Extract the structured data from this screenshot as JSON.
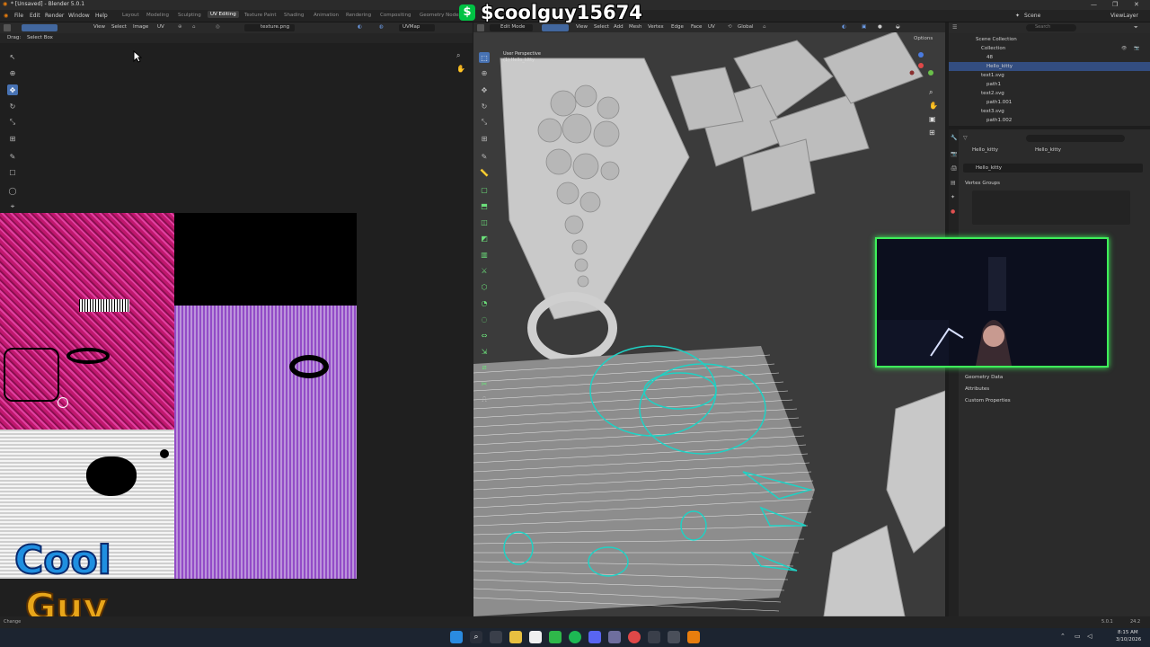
{
  "window": {
    "title": "* [Unsaved] - Blender 5.0.1",
    "controls": [
      "—",
      "❐",
      "✕"
    ]
  },
  "stream_overlay": {
    "username": "$coolguy15674",
    "cash_symbol": "$",
    "logo_text_1": "Cool",
    "logo_text_2": "Guy"
  },
  "menu": [
    "File",
    "Edit",
    "Render",
    "Window",
    "Help"
  ],
  "workspaces": [
    {
      "label": "Layout",
      "active": false
    },
    {
      "label": "Modeling",
      "active": false
    },
    {
      "label": "Sculpting",
      "active": false
    },
    {
      "label": "UV Editing",
      "active": true
    },
    {
      "label": "Texture Paint",
      "active": false
    },
    {
      "label": "Shading",
      "active": false
    },
    {
      "label": "Animation",
      "active": false
    },
    {
      "label": "Rendering",
      "active": false
    },
    {
      "label": "Compositing",
      "active": false
    },
    {
      "label": "Geometry Nodes",
      "active": false
    }
  ],
  "top_right": {
    "scene": "Scene",
    "view_layer": "ViewLayer"
  },
  "uv_editor": {
    "header": [
      "View",
      "Select",
      "Image",
      "UV"
    ],
    "image_name": "texture.png",
    "uv_map": "UVMap",
    "subheader": [
      "Drag:",
      "Select Box"
    ]
  },
  "viewport": {
    "mode": "Edit Mode",
    "header": [
      "View",
      "Select",
      "Add",
      "Mesh",
      "Vertex",
      "Edge",
      "Face",
      "UV"
    ],
    "transform": "Global",
    "options": "Options",
    "overlay_text_1": "User Perspective",
    "overlay_text_2": "(1) Hello_kitty"
  },
  "outliner": {
    "search_placeholder": "Search",
    "rows": [
      {
        "label": "Scene Collection",
        "selected": false,
        "indent": 0
      },
      {
        "label": "Collection",
        "selected": false,
        "indent": 1
      },
      {
        "label": "48",
        "selected": false,
        "indent": 2
      },
      {
        "label": "Hello_kitty",
        "selected": true,
        "indent": 2
      },
      {
        "label": "text1.svg",
        "selected": false,
        "indent": 1
      },
      {
        "label": "path1",
        "selected": false,
        "indent": 2
      },
      {
        "label": "text2.svg",
        "selected": false,
        "indent": 1
      },
      {
        "label": "path1.001",
        "selected": false,
        "indent": 2
      },
      {
        "label": "text3.svg",
        "selected": false,
        "indent": 1
      },
      {
        "label": "path1.002",
        "selected": false,
        "indent": 2
      }
    ]
  },
  "properties": {
    "breadcrumb_1": "Hello_kitty",
    "breadcrumb_2": "Hello_kitty",
    "object_name": "Hello_kitty",
    "sections": [
      "Vertex Groups",
      "Geometry Data",
      "Attributes",
      "Custom Properties"
    ]
  },
  "statusbar": {
    "left": "Change",
    "version": "5.0.1",
    "right": "24.2"
  },
  "taskbar": {
    "time": "8:15 AM",
    "date": "3/10/2026"
  },
  "colors": {
    "accent": "#4772b3",
    "selection": "#334d80",
    "webcam_border": "#3ef05a",
    "edit_wire": "#1fd1c4"
  }
}
